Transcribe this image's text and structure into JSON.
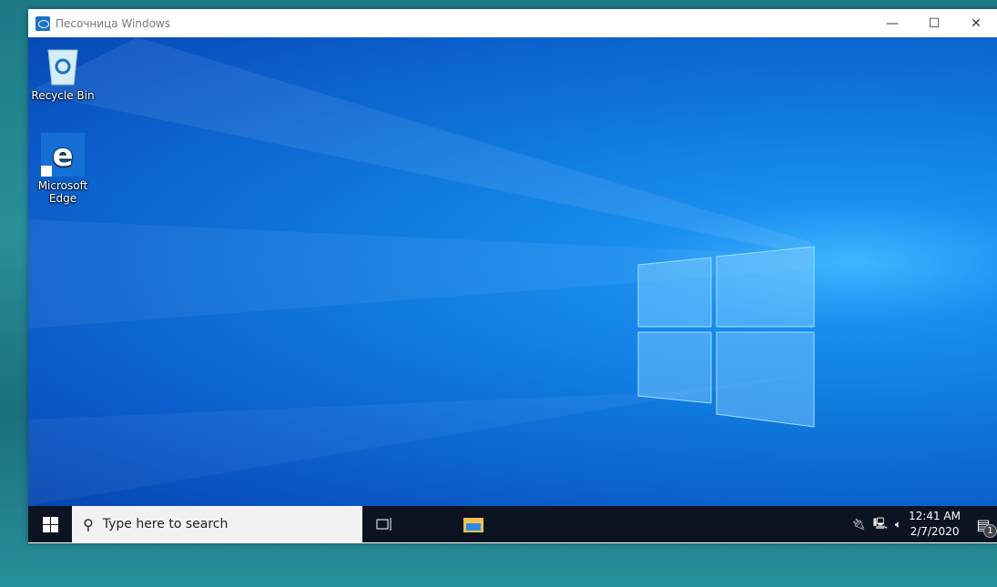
{
  "window": {
    "title": "Песочница Windows",
    "minimize": "—",
    "maximize": "☐",
    "close": "✕"
  },
  "desktop": {
    "icons": [
      {
        "label": "Recycle Bin",
        "icon": "recycle-bin-icon"
      },
      {
        "label": "Microsoft Edge",
        "icon": "edge-icon"
      }
    ]
  },
  "taskbar": {
    "search_placeholder": "Type here to search",
    "time": "12:41 AM",
    "date": "2/7/2020",
    "notification_count": "1"
  }
}
